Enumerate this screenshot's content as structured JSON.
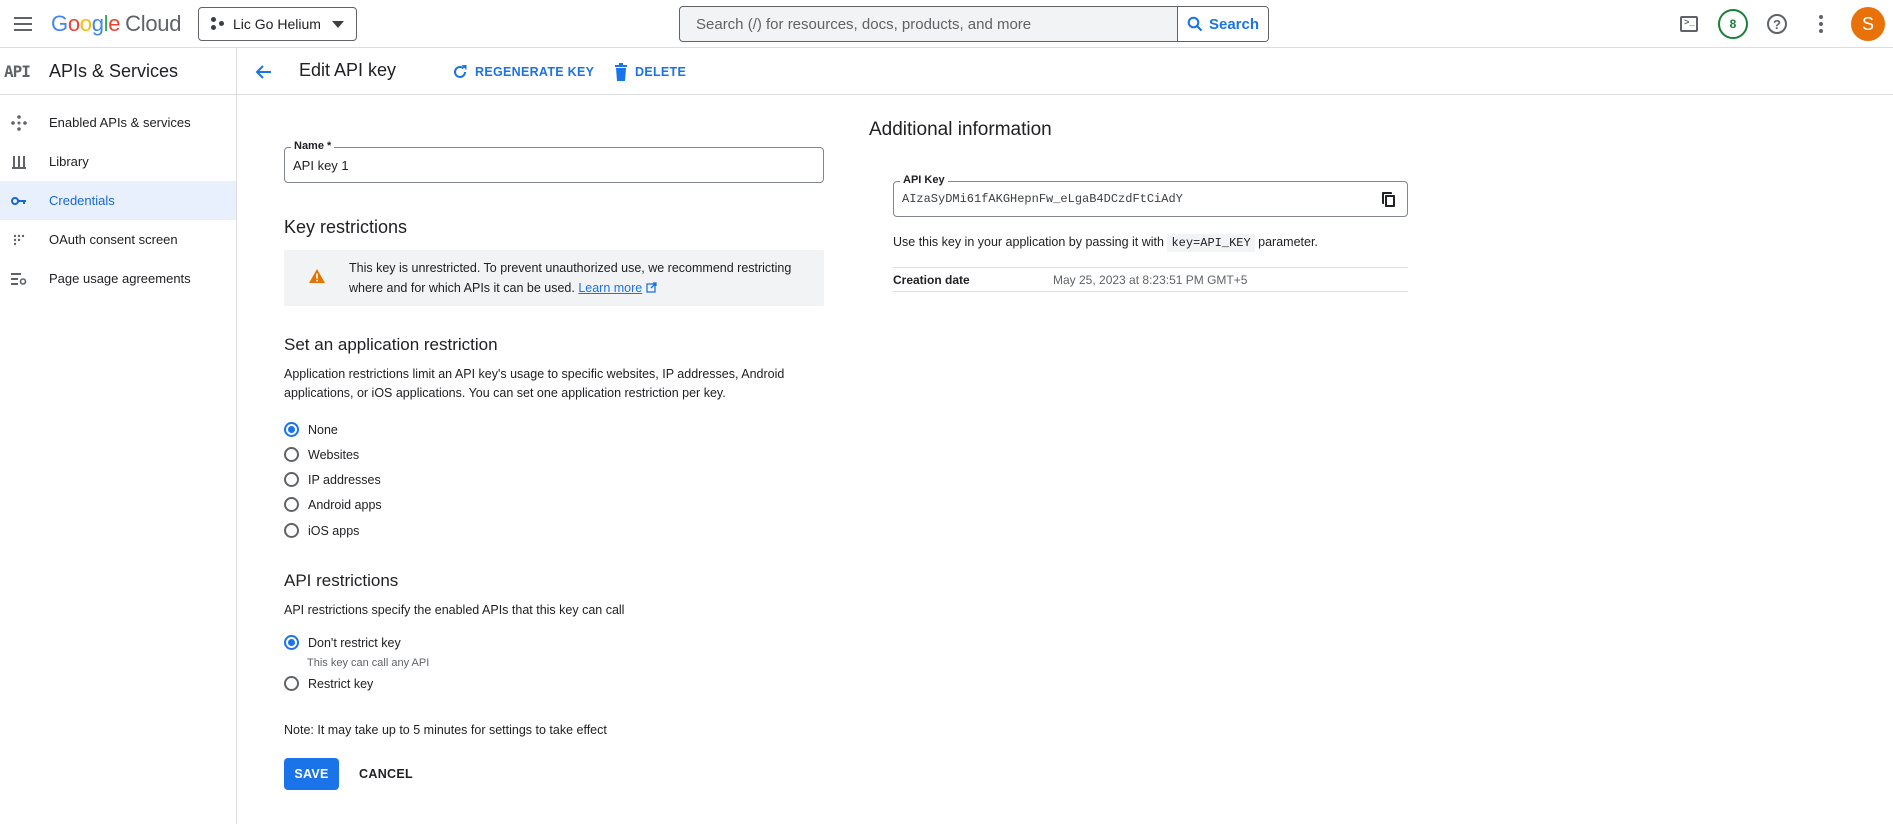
{
  "topbar": {
    "logo": {
      "g1": "G",
      "o1": "o",
      "o2": "o",
      "g2": "g",
      "l": "l",
      "e": "e",
      "cloud": "Cloud"
    },
    "project_name": "Lic Go Helium",
    "search_placeholder": "Search (/) for resources, docs, products, and more",
    "search_button": "Search",
    "notification_count": "8",
    "help_glyph": "?",
    "avatar_initial": "S",
    "icons": [
      "menu-icon",
      "project-icon",
      "search-icon",
      "cloud-shell-icon",
      "notifications-icon",
      "help-icon",
      "more-vert-icon"
    ]
  },
  "product": {
    "logo": "API",
    "title": "APIs & Services"
  },
  "header": {
    "page_title": "Edit API key",
    "regenerate_label": "REGENERATE KEY",
    "delete_label": "DELETE"
  },
  "sidebar": {
    "items": [
      {
        "label": "Enabled APIs & services",
        "icon": "diamond-dots-icon",
        "active": false
      },
      {
        "label": "Library",
        "icon": "library-icon",
        "active": false
      },
      {
        "label": "Credentials",
        "icon": "key-icon",
        "active": true
      },
      {
        "label": "OAuth consent screen",
        "icon": "grid-dots-icon",
        "active": false
      },
      {
        "label": "Page usage agreements",
        "icon": "settings-list-icon",
        "active": false
      }
    ]
  },
  "form": {
    "name_label": "Name *",
    "name_value": "API key 1",
    "key_restrictions_heading": "Key restrictions",
    "warning_text": "This key is unrestricted. To prevent unauthorized use, we recommend restricting where and for which APIs it can be used.",
    "warning_link": "Learn more",
    "app_restriction_heading": "Set an application restriction",
    "app_restriction_desc": "Application restrictions limit an API key's usage to specific websites, IP addresses, Android applications, or iOS applications. You can set one application restriction per key.",
    "app_options": [
      "None",
      "Websites",
      "IP addresses",
      "Android apps",
      "iOS apps"
    ],
    "app_selected": "None",
    "api_restrictions_heading": "API restrictions",
    "api_restrictions_desc": "API restrictions specify the enabled APIs that this key can call",
    "api_options": [
      "Don't restrict key",
      "Restrict key"
    ],
    "api_option_sub": "This key can call any API",
    "api_selected": "Don't restrict key",
    "note": "Note: It may take up to 5 minutes for settings to take effect",
    "save_label": "SAVE",
    "cancel_label": "CANCEL"
  },
  "info": {
    "heading": "Additional information",
    "api_key_label": "API Key",
    "api_key_value": "AIzaSyDMi61fAKGHepnFw_eLgaB4DCzdFtCiAdY",
    "usage_prefix": "Use this key in your application by passing it with",
    "usage_code": "key=API_KEY",
    "usage_suffix": "parameter.",
    "creation_label": "Creation date",
    "creation_value": "May 25, 2023 at 8:23:51 PM GMT+5"
  },
  "colors": {
    "accent": "#1a73e8",
    "warning": "#e37400",
    "avatar": "#e8710a",
    "notif": "#188038",
    "active_nav_bg": "#e8f0fe"
  }
}
